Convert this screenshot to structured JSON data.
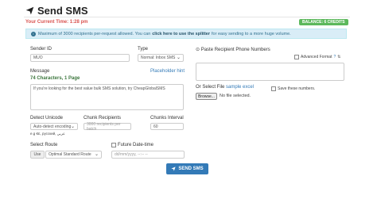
{
  "header": {
    "title": "Send SMS",
    "current_time": "Your Current Time: 1:28 pm",
    "balance": "BALANCE: 6 CREDITS"
  },
  "info": {
    "prefix": "Maximum of 3000 recipients per-request allowed. You can ",
    "link": "click here to use the splitter",
    "suffix": " for easy sending to a more huge volume."
  },
  "sender": {
    "label": "Sender ID",
    "value": "MUO"
  },
  "type": {
    "label": "Type",
    "value": "Normal: Inbox SMS"
  },
  "paste": {
    "label": "Paste Recipient Phone Numbers"
  },
  "advanced": {
    "label": "Advanced Format"
  },
  "message": {
    "label": "Message",
    "placeholder_link": "Placeholder hint",
    "count": "74 Characters, 1 Page",
    "value": "If you're looking for the best value bulk SMS solution, try CheapGlobalSMS"
  },
  "file": {
    "label": "Or Select File",
    "sample": "sample excel",
    "button": "Browse...",
    "status": "No file selected."
  },
  "save_numbers": {
    "label": "Save these numbers."
  },
  "unicode": {
    "label": "Detect Unicode",
    "value": "Auto-detect encoding",
    "hint": "e.g €£, русский, عربي"
  },
  "chunk_recipients": {
    "label": "Chunk Recipients",
    "placeholder": "3000 recipients per batch"
  },
  "chunks_interval": {
    "label": "Chunks Interval",
    "value": "60"
  },
  "route": {
    "label": "Select Route",
    "prefix": "Use",
    "value": "Optimal Standard Route"
  },
  "future": {
    "label": "Future Date-time",
    "placeholder": "dd/mm/yyyy, --:-- --"
  },
  "send": {
    "label": "SEND SMS"
  },
  "colors": {
    "accent": "#337ab7",
    "danger": "#d9534f",
    "success": "#5cb85c",
    "info_bg": "#d9edf7"
  }
}
